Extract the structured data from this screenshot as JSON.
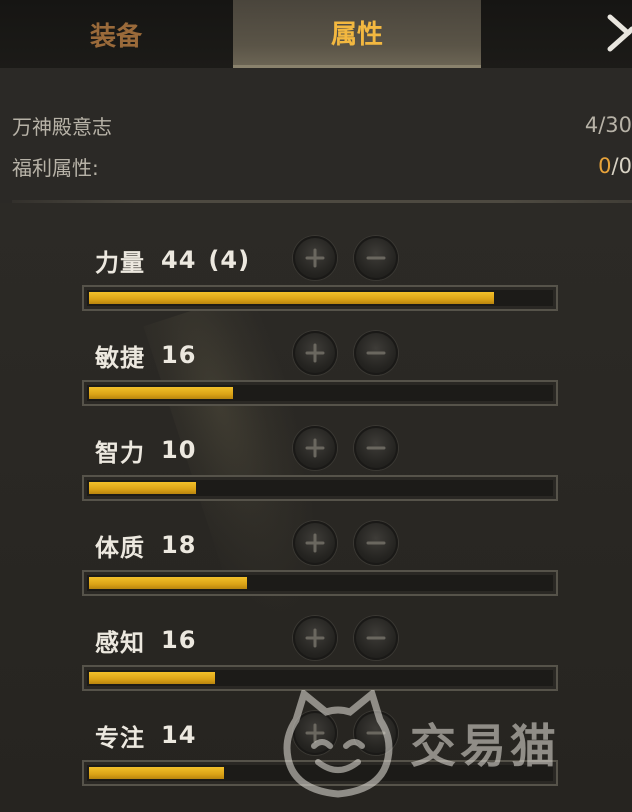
{
  "tabs": {
    "equipment_label": "装备",
    "attributes_label": "属性"
  },
  "info": {
    "will_label": "万神殿意志",
    "will_value": "4/30",
    "bonus_label": "福利属性:",
    "bonus_current": "0",
    "bonus_sep": "/",
    "bonus_max": "0"
  },
  "stats": [
    {
      "name": "力量",
      "value": "44",
      "bonus": "(4)",
      "fill_fraction": 0.87
    },
    {
      "name": "敏捷",
      "value": "16",
      "bonus": "",
      "fill_fraction": 0.31
    },
    {
      "name": "智力",
      "value": "10",
      "bonus": "",
      "fill_fraction": 0.23
    },
    {
      "name": "体质",
      "value": "18",
      "bonus": "",
      "fill_fraction": 0.34
    },
    {
      "name": "感知",
      "value": "16",
      "bonus": "",
      "fill_fraction": 0.27
    },
    {
      "name": "专注",
      "value": "14",
      "bonus": "",
      "fill_fraction": 0.29
    }
  ],
  "buttons": {
    "plus_icon": "plus-icon",
    "minus_icon": "minus-icon",
    "close_icon": "close-icon"
  },
  "watermark": {
    "text": "交易猫"
  },
  "colors": {
    "active_tab_text": "#f3b840",
    "inactive_tab_text": "#9a6a3a",
    "bar_fill": "#e0a81a",
    "bonus_highlight": "#e8a33a"
  }
}
